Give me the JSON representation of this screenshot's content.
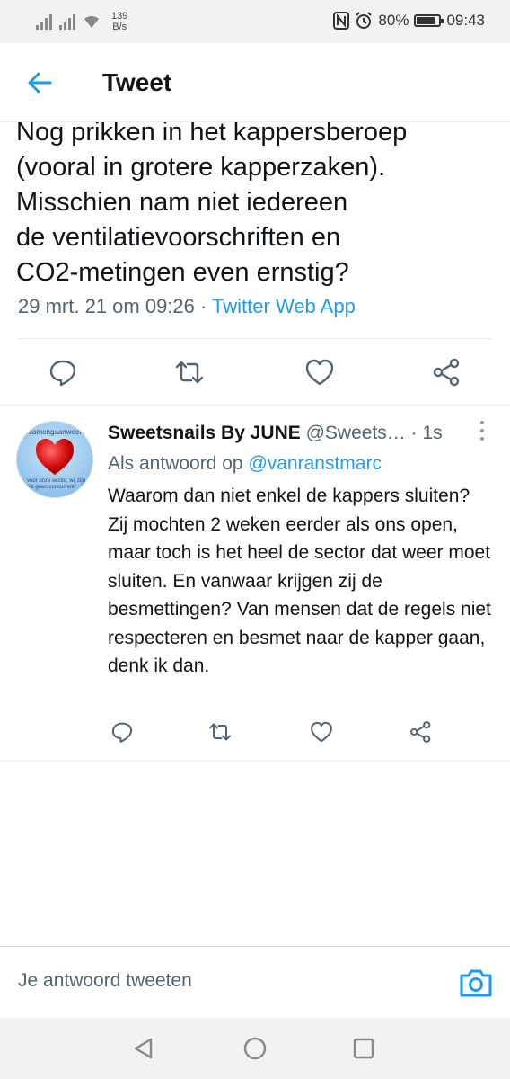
{
  "status_bar": {
    "network_speed_value": "139",
    "network_speed_unit": "B/s",
    "battery": "80%",
    "time": "09:43"
  },
  "header": {
    "title": "Tweet",
    "back_icon": "arrow-left-icon"
  },
  "main_tweet": {
    "text_lines": [
      "Nog prikken in het kappersberoep",
      "(vooral in grotere kapperzaken).",
      "Misschien nam niet iedereen",
      "de ventilatievoorschriften en",
      "CO2-metingen even ernstig?"
    ],
    "timestamp": "29 mrt. 21 om 09:26",
    "separator": " · ",
    "source_app": "Twitter Web App",
    "actions": [
      "reply-icon",
      "retweet-icon",
      "like-icon",
      "share-icon"
    ]
  },
  "reply": {
    "display_name": "Sweetsnails By JUNE",
    "handle": "@Sweets…",
    "time": "1s",
    "time_separator": " · ",
    "replying_prefix": "Als antwoord op ",
    "replying_to": "@vanranstmarc",
    "avatar_text_top": "samengaanweeropen",
    "avatar_text_bottom": "voor onze sector, wij zijn als geen concurrent",
    "text": "Waarom dan niet enkel de kappers sluiten? Zij mochten 2 weken eerder als ons open, maar toch is het heel de sector dat weer moet sluiten. En vanwaar krijgen zij de besmettingen? Van mensen dat de regels niet respecteren en besmet naar de kapper gaan, denk ik dan.",
    "actions": [
      "reply-icon",
      "retweet-icon",
      "like-icon",
      "share-icon"
    ]
  },
  "compose": {
    "placeholder": "Je antwoord tweeten",
    "camera_icon": "camera-icon"
  },
  "navigation": [
    "back-triangle-icon",
    "home-circle-icon",
    "recents-square-icon"
  ],
  "colors": {
    "accent": "#1d9bf0",
    "text": "#0f1419",
    "secondary": "#536471",
    "divider": "#e6ecf0"
  }
}
